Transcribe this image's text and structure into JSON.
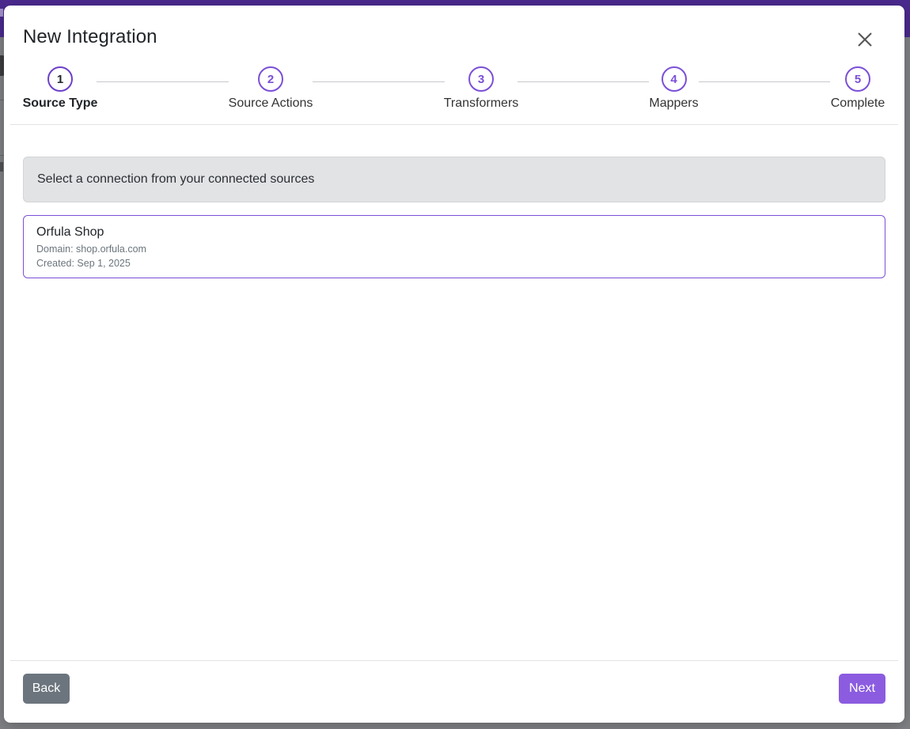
{
  "modal": {
    "title": "New Integration",
    "close_icon": "close-icon"
  },
  "stepper": {
    "steps": [
      {
        "number": "1",
        "label": "Source Type",
        "active": true
      },
      {
        "number": "2",
        "label": "Source Actions",
        "active": false
      },
      {
        "number": "3",
        "label": "Transformers",
        "active": false
      },
      {
        "number": "4",
        "label": "Mappers",
        "active": false
      },
      {
        "number": "5",
        "label": "Complete",
        "active": false
      }
    ]
  },
  "info": {
    "message": "Select a connection from your connected sources"
  },
  "connections": [
    {
      "name": "Orfula Shop",
      "domain": "Domain: shop.orfula.com",
      "created": "Created: Sep 1, 2025"
    }
  ],
  "footer": {
    "back_label": "Back",
    "next_label": "Next"
  },
  "colors": {
    "accent": "#7b4fd6",
    "next_button": "#8b5ce0",
    "back_button": "#6c757d",
    "info_bg": "#e2e3e5",
    "topbar": "#4b2a8f"
  }
}
